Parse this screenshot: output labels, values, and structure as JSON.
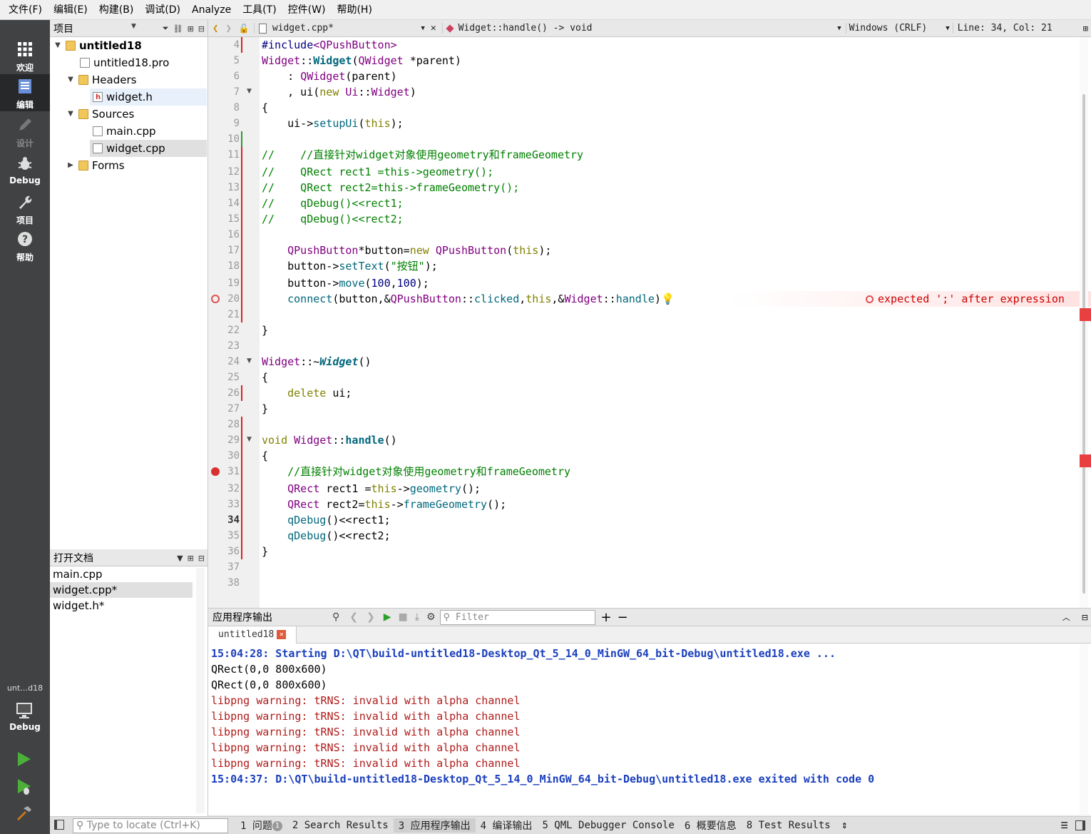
{
  "menu": [
    "文件(F)",
    "编辑(E)",
    "构建(B)",
    "调试(D)",
    "Analyze",
    "工具(T)",
    "控件(W)",
    "帮助(H)"
  ],
  "modes": [
    {
      "label": "欢迎",
      "icon": "grid-icon"
    },
    {
      "label": "编辑",
      "icon": "edit-icon"
    },
    {
      "label": "设计",
      "icon": "pencil-icon"
    },
    {
      "label": "Debug",
      "icon": "bug-icon"
    },
    {
      "label": "项目",
      "icon": "wrench-icon"
    },
    {
      "label": "帮助",
      "icon": "help-icon"
    }
  ],
  "kit": {
    "project": "unt…d18",
    "mode": "Debug"
  },
  "navigator": {
    "title": "项目",
    "tree": {
      "root": "untitled18",
      "pro": "untitled18.pro",
      "headers": "Headers",
      "widget_h": "widget.h",
      "sources": "Sources",
      "main_cpp": "main.cpp",
      "widget_cpp": "widget.cpp",
      "forms": "Forms"
    }
  },
  "open_documents": {
    "title": "打开文档",
    "items": [
      "main.cpp",
      "widget.cpp*",
      "widget.h*"
    ]
  },
  "editor": {
    "file": "widget.cpp*",
    "symbol": "Widget::handle() -> void",
    "encoding": "Windows (CRLF)",
    "position": "Line: 34, Col: 21",
    "error": "expected ';' after expression"
  },
  "output": {
    "title": "应用程序输出",
    "filter_placeholder": "Filter",
    "tab": "untitled18",
    "lines": [
      "15:04:28: Starting D:\\QT\\build-untitled18-Desktop_Qt_5_14_0_MinGW_64_bit-Debug\\untitled18.exe ...",
      "QRect(0,0 800x600)",
      "QRect(0,0 800x600)",
      "libpng warning: tRNS: invalid with alpha channel",
      "libpng warning: tRNS: invalid with alpha channel",
      "libpng warning: tRNS: invalid with alpha channel",
      "libpng warning: tRNS: invalid with alpha channel",
      "libpng warning: tRNS: invalid with alpha channel",
      "15:04:37: D:\\QT\\build-untitled18-Desktop_Qt_5_14_0_MinGW_64_bit-Debug\\untitled18.exe exited with code 0"
    ]
  },
  "statusbar": {
    "locate_placeholder": "Type to locate (Ctrl+K)",
    "tabs": [
      "1 问题",
      "2 Search Results",
      "3 应用程序输出",
      "4 编译输出",
      "5 QML Debugger Console",
      "6 概要信息",
      "8 Test Results"
    ],
    "issues_count": "1"
  }
}
